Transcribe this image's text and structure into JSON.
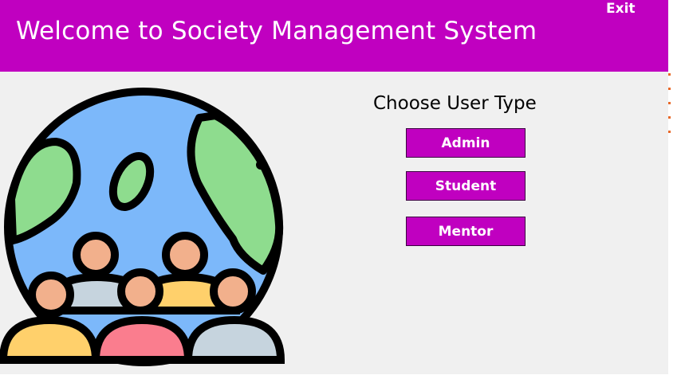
{
  "header": {
    "title": "Welcome to Society Management System",
    "exit_label": "Exit",
    "background": "#c000c0"
  },
  "main": {
    "choose_label": "Choose User Type",
    "buttons": [
      {
        "label": "Admin"
      },
      {
        "label": "Student"
      },
      {
        "label": "Mentor"
      }
    ]
  },
  "illustration": {
    "icon": "globe-with-people-icon",
    "colors": {
      "ocean": "#7cb8fa",
      "land": "#8edc8e",
      "skin": "#f2b08c",
      "shirt_grey": "#c6d4de",
      "shirt_yellow": "#ffd06b",
      "shirt_pink": "#fa7d8e",
      "outline": "#000000"
    }
  }
}
